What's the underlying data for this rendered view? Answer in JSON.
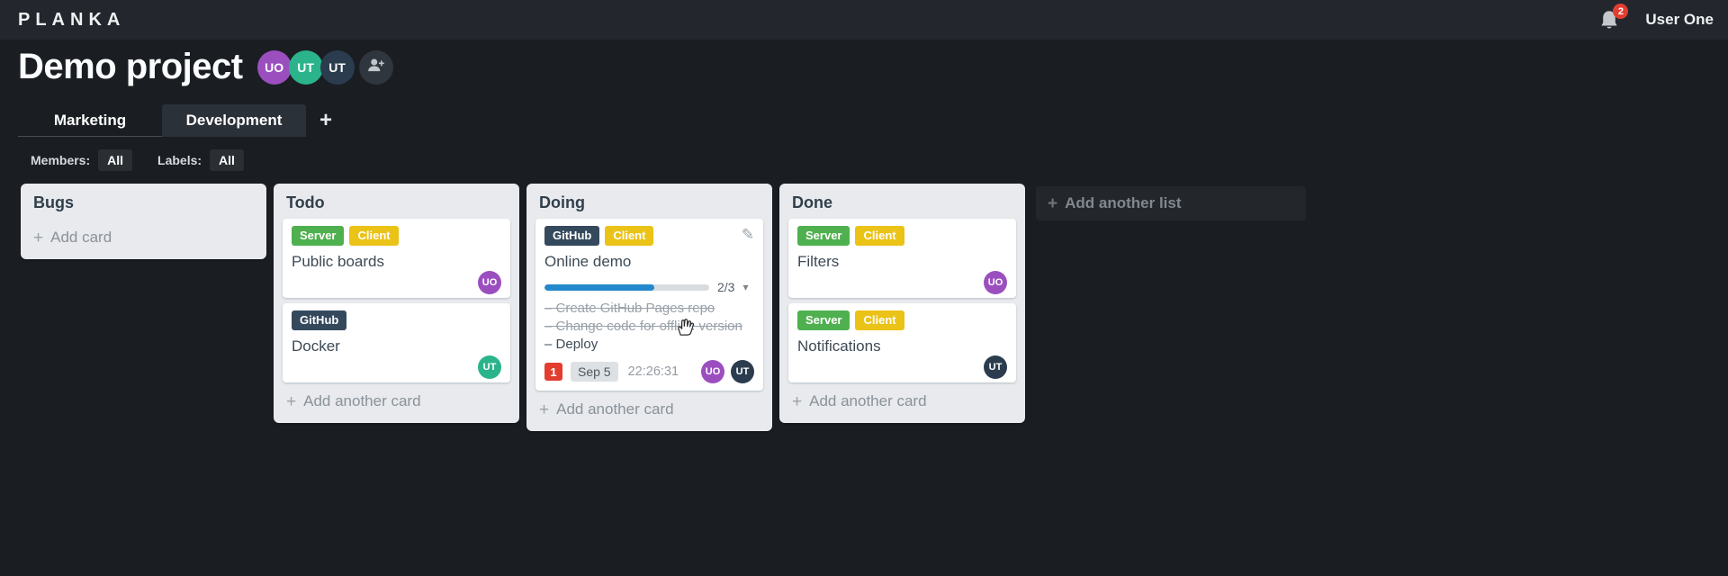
{
  "topbar": {
    "logo": "PLANKA",
    "notifications_count": "2",
    "user_name": "User One"
  },
  "header": {
    "title": "Demo project",
    "members": [
      {
        "initials": "UO",
        "color": "#9b4fbf"
      },
      {
        "initials": "UT",
        "color": "#2bb48c"
      },
      {
        "initials": "UT",
        "color": "#2b3c4e"
      }
    ]
  },
  "tabs": {
    "items": [
      {
        "label": "Marketing"
      },
      {
        "label": "Development"
      }
    ],
    "add_label": "+"
  },
  "filters": {
    "members_label": "Members:",
    "members_value": "All",
    "labels_label": "Labels:",
    "labels_value": "All"
  },
  "board": {
    "add_list_label": "Add another list",
    "label_colors": {
      "green": "#4fb04f",
      "yellow": "#ebc216",
      "navy": "#35495d"
    },
    "accent_colors": {
      "progress_blue": "#2489cc",
      "alert_red": "#e23e30"
    },
    "lists": [
      {
        "title": "Bugs",
        "footer": "Add card",
        "cards": []
      },
      {
        "title": "Todo",
        "footer": "Add another card",
        "cards": [
          {
            "title": "Public boards",
            "labels": [
              {
                "text": "Server",
                "color": "#4fb04f"
              },
              {
                "text": "Client",
                "color": "#ebc216"
              }
            ],
            "avatars": [
              {
                "initials": "UO",
                "color": "#9b4fbf"
              }
            ]
          },
          {
            "title": "Docker",
            "labels": [
              {
                "text": "GitHub",
                "color": "#35495d"
              }
            ],
            "avatars": [
              {
                "initials": "UT",
                "color": "#2bb48c"
              }
            ]
          }
        ]
      },
      {
        "title": "Doing",
        "footer": "Add another card",
        "cards": [
          {
            "title": "Online demo",
            "labels": [
              {
                "text": "GitHub",
                "color": "#35495d"
              },
              {
                "text": "Client",
                "color": "#ebc216"
              }
            ],
            "editable": true,
            "progress": {
              "label": "2/3",
              "percent": 66.7
            },
            "tasks": [
              {
                "text": "Create GitHub Pages repo",
                "done": true
              },
              {
                "text": "Change code for offline version",
                "done": true
              },
              {
                "text": "Deploy",
                "done": false
              }
            ],
            "badges": {
              "count": "1",
              "due_date": "Sep 5",
              "timer": "22:26:31"
            },
            "avatars": [
              {
                "initials": "UO",
                "color": "#9b4fbf"
              },
              {
                "initials": "UT",
                "color": "#2b3c4e"
              }
            ]
          }
        ]
      },
      {
        "title": "Done",
        "footer": "Add another card",
        "cards": [
          {
            "title": "Filters",
            "labels": [
              {
                "text": "Server",
                "color": "#4fb04f"
              },
              {
                "text": "Client",
                "color": "#ebc216"
              }
            ],
            "avatars": [
              {
                "initials": "UO",
                "color": "#9b4fbf"
              }
            ]
          },
          {
            "title": "Notifications",
            "labels": [
              {
                "text": "Server",
                "color": "#4fb04f"
              },
              {
                "text": "Client",
                "color": "#ebc216"
              }
            ],
            "avatars": [
              {
                "initials": "UT",
                "color": "#2b3c4e"
              }
            ]
          }
        ]
      }
    ]
  }
}
